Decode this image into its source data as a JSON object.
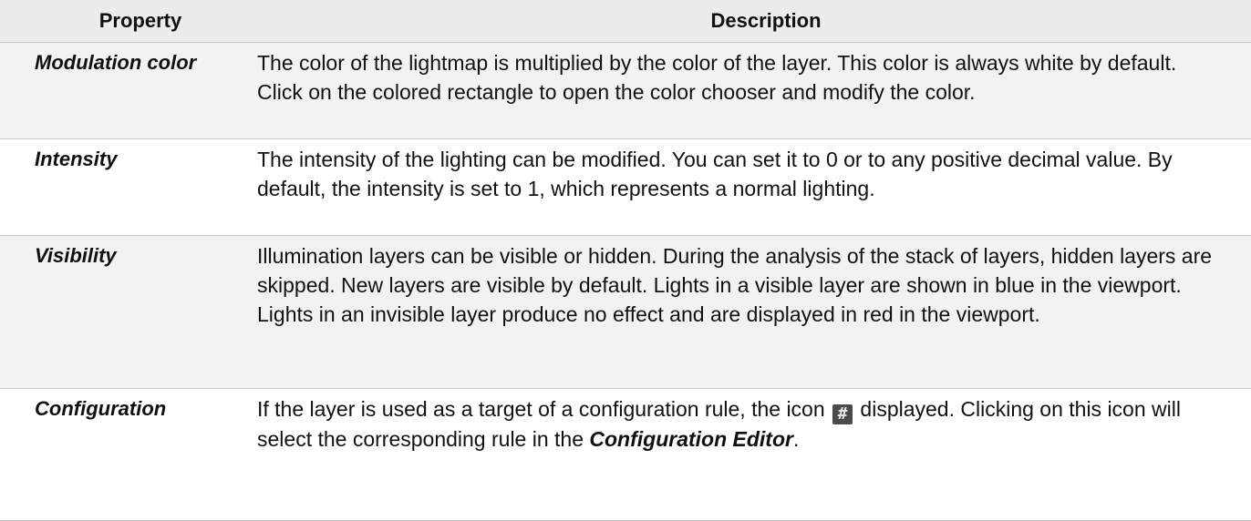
{
  "table": {
    "headers": {
      "property": "Property",
      "description": "Description"
    },
    "rows": [
      {
        "property": "Modulation color",
        "description": "The color of the lightmap is multiplied by the color of the layer. This color is always white by default. Click on the colored rectangle to open the color chooser and modify the color."
      },
      {
        "property": "Intensity",
        "description": "The intensity of the lighting can be modified. You can set it to 0 or to any positive decimal value. By default, the intensity is set to 1, which represents a normal lighting."
      },
      {
        "property": "Visibility",
        "description": "Illumination layers can be visible or hidden. During the analysis of the stack of layers, hidden layers are skipped. New layers are visible by default. Lights in a visible layer are shown in blue in the viewport. Lights in an invisible layer produce no effect and are displayed in red in the viewport."
      },
      {
        "property": "Configuration",
        "description_part1": "If the layer is used as a target of a configuration rule, the icon",
        "icon": "hash-icon",
        "description_part2": "displayed. Clicking on this icon will select the corresponding rule in the",
        "emphasis": "Configuration Editor",
        "description_part3": "."
      }
    ]
  }
}
